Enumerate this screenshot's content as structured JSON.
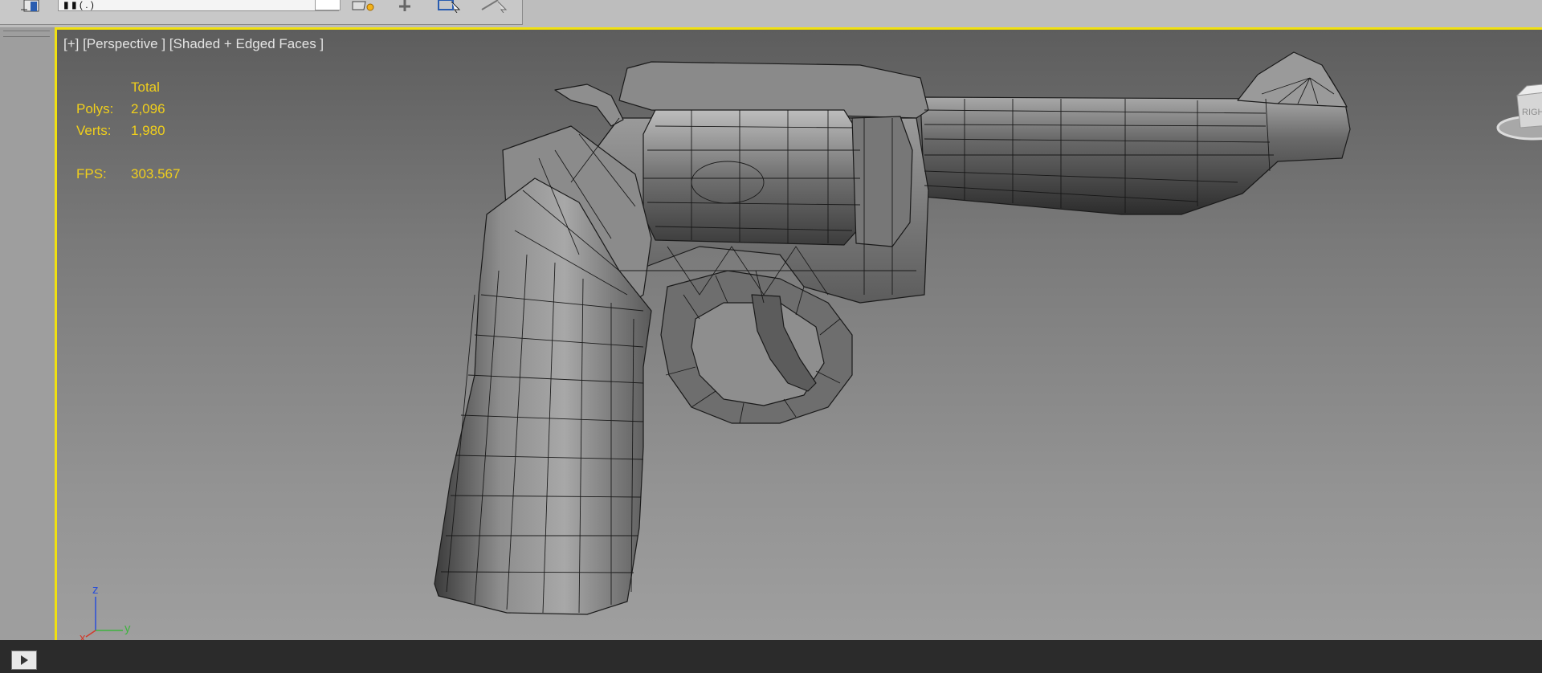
{
  "toolbar": {
    "field_text": "  ▮ ▮ (  . )",
    "icons": [
      "layer-icon",
      "select-object-icon",
      "select-and-move-icon",
      "select-region-icon",
      "window-crossing-icon"
    ]
  },
  "viewport": {
    "label": "[+] [Perspective ] [Shaded + Edged Faces ]",
    "stats": {
      "header": "Total",
      "polys_label": "Polys:",
      "polys_value": "2,096",
      "verts_label": "Verts:",
      "verts_value": "1,980",
      "fps_label": "FPS:",
      "fps_value": "303.567"
    },
    "axes": {
      "x": "x",
      "y": "y",
      "z": "z"
    },
    "viewcube_label": "RIGHT"
  },
  "colors": {
    "active_viewport_border": "#f0e010",
    "stats_text": "#f0cf1c",
    "axis_x": "#d23a2a",
    "axis_y": "#3fb33f",
    "axis_z": "#2a4fd8"
  }
}
